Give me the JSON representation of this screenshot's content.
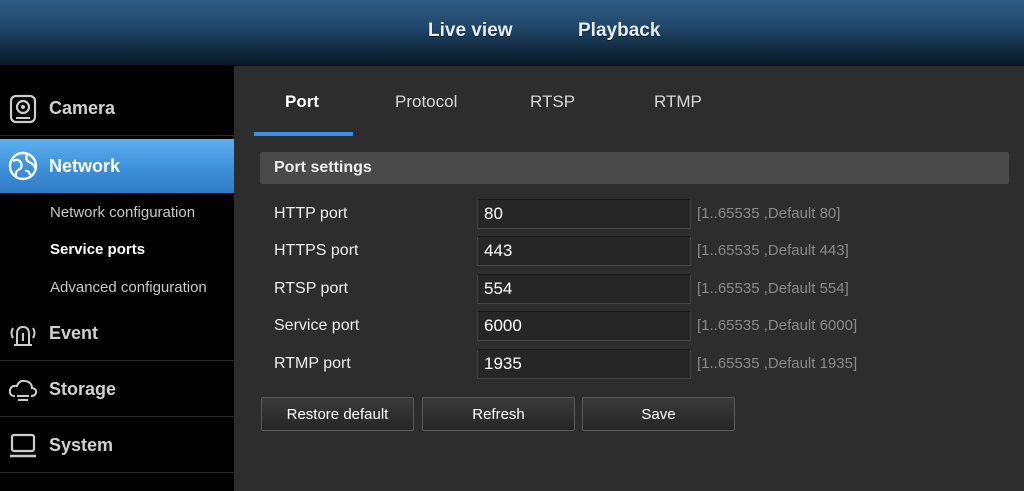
{
  "top_nav": {
    "live_view": "Live view",
    "playback": "Playback"
  },
  "sidebar": {
    "items": [
      {
        "label": "Camera",
        "icon": "camera-icon"
      },
      {
        "label": "Network",
        "icon": "network-globe-icon",
        "active": true
      },
      {
        "label": "Event",
        "icon": "alarm-icon"
      },
      {
        "label": "Storage",
        "icon": "cloud-storage-icon"
      },
      {
        "label": "System",
        "icon": "monitor-icon"
      }
    ],
    "network_subitems": [
      {
        "label": "Network configuration"
      },
      {
        "label": "Service ports",
        "active": true
      },
      {
        "label": "Advanced configuration"
      }
    ]
  },
  "tabs": [
    {
      "label": "Port",
      "active": true
    },
    {
      "label": "Protocol"
    },
    {
      "label": "RTSP"
    },
    {
      "label": "RTMP"
    }
  ],
  "panel": {
    "title": "Port settings",
    "rows": [
      {
        "label": "HTTP port",
        "value": "80",
        "hint": "[1..65535 ,Default 80]"
      },
      {
        "label": "HTTPS port",
        "value": "443",
        "hint": "[1..65535 ,Default 443]"
      },
      {
        "label": "RTSP port",
        "value": "554",
        "hint": "[1..65535 ,Default 554]"
      },
      {
        "label": "Service port",
        "value": "6000",
        "hint": "[1..65535 ,Default 6000]"
      },
      {
        "label": "RTMP port",
        "value": "1935",
        "hint": "[1..65535 ,Default 1935]"
      }
    ]
  },
  "buttons": {
    "restore": "Restore default",
    "refresh": "Refresh",
    "save": "Save"
  },
  "colors": {
    "accent": "#3a8ee6",
    "active_sidebar": "#3d8fd8",
    "background": "#2d2d2d",
    "sidebar_bg": "#000000"
  }
}
